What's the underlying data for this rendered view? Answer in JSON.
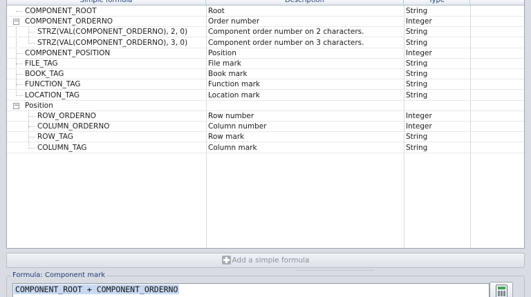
{
  "columns": {
    "formula": "Simple formula",
    "description": "Description",
    "type": "Type"
  },
  "rows": [
    {
      "formula": "COMPONENT_ROOT",
      "description": "Root",
      "type": "String"
    },
    {
      "formula": "COMPONENT_ORDERNO",
      "description": "Order number",
      "type": "Integer",
      "expander": "−"
    },
    {
      "formula": "STRZ(VAL(COMPONENT_ORDERNO), 2, 0)",
      "description": "Component order number on 2 characters.",
      "type": "String"
    },
    {
      "formula": "STRZ(VAL(COMPONENT_ORDERNO), 3, 0)",
      "description": "Component order number on 3 characters.",
      "type": "String"
    },
    {
      "formula": "COMPONENT_POSITION",
      "description": "Position",
      "type": "Integer"
    },
    {
      "formula": "FILE_TAG",
      "description": "File mark",
      "type": "String"
    },
    {
      "formula": "BOOK_TAG",
      "description": "Book mark",
      "type": "String"
    },
    {
      "formula": "FUNCTION_TAG",
      "description": "Function mark",
      "type": "String"
    },
    {
      "formula": "LOCATION_TAG",
      "description": "Location mark",
      "type": "String"
    },
    {
      "formula": "Position",
      "description": "",
      "type": "",
      "expander": "−"
    },
    {
      "formula": "ROW_ORDERNO",
      "description": "Row number",
      "type": "Integer"
    },
    {
      "formula": "COLUMN_ORDERNO",
      "description": "Column number",
      "type": "Integer"
    },
    {
      "formula": "ROW_TAG",
      "description": "Row mark",
      "type": "String"
    },
    {
      "formula": "COLUMN_TAG",
      "description": "Column mark",
      "type": "String"
    }
  ],
  "add_button_label": "Add a simple formula",
  "formula_panel": {
    "legend": "Formula: Component mark",
    "value": "COMPONENT_ROOT + COMPONENT_ORDERNO"
  },
  "icons": {
    "add": "plus-icon",
    "calculator": "calculator-icon",
    "expander": "tree-expander-icon"
  }
}
